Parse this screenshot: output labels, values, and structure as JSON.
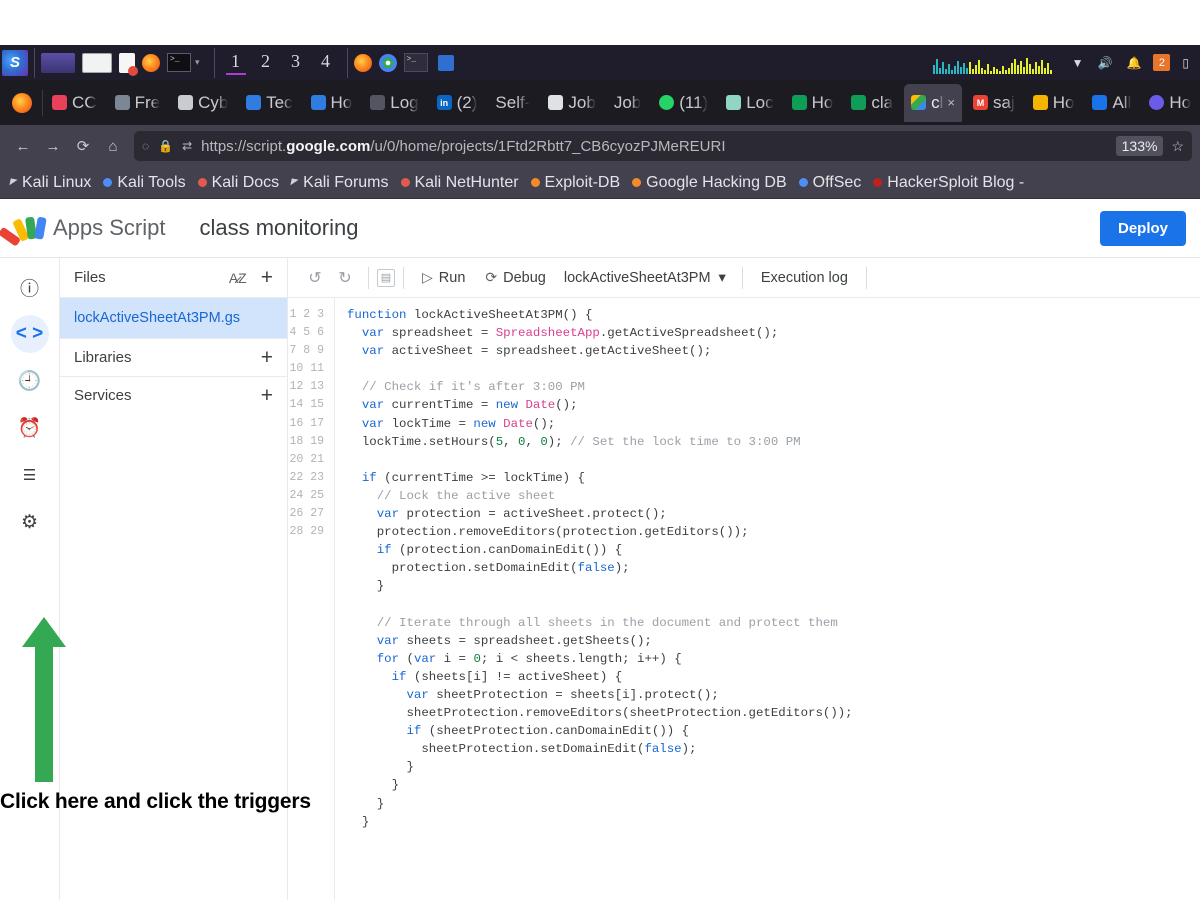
{
  "os_taskbar": {
    "workspaces": [
      "1",
      "2",
      "3",
      "4"
    ],
    "active_workspace": "1",
    "tray": {
      "wifi_icon": "wifi-icon",
      "volume_icon": "volume-icon",
      "bell_icon": "notification-bell-icon",
      "updates_badge": "2",
      "visualizer_label": "audio-visualizer"
    },
    "launchers": [
      "kali-menu",
      "window-purple",
      "window-white",
      "file-manager",
      "firefox",
      "terminal"
    ]
  },
  "browser": {
    "tabs": [
      {
        "label": "CC",
        "favicon": "chat-icon",
        "color": "#e8415a",
        "active": false
      },
      {
        "label": "Fre",
        "favicon": "grid-icon",
        "color": "#7b8794",
        "active": false
      },
      {
        "label": "Cyb",
        "favicon": "cyber-icon",
        "color": "#c8ccd1",
        "active": false
      },
      {
        "label": "Tec",
        "favicon": "doc-icon",
        "color": "#2f7de1",
        "active": false
      },
      {
        "label": "Ho",
        "favicon": "doc-icon",
        "color": "#2f7de1",
        "active": false
      },
      {
        "label": "Log",
        "favicon": "blank-icon",
        "color": "#555561",
        "active": false
      },
      {
        "label": "(2)",
        "favicon": "linkedin-icon",
        "color": "#0a66c2",
        "active": false
      },
      {
        "label": "Self-",
        "favicon": "blank-icon",
        "color": "#555561",
        "active": false
      },
      {
        "label": "Job",
        "favicon": "ghost-icon",
        "color": "#dfe1e5",
        "active": false
      },
      {
        "label": "Job",
        "favicon": "blank-icon",
        "color": "#555561",
        "active": false
      },
      {
        "label": "(11)",
        "favicon": "whatsapp-icon",
        "color": "#25d366",
        "active": false
      },
      {
        "label": "Loc",
        "favicon": "sheets-icon",
        "color": "#8fd6c4",
        "active": false
      },
      {
        "label": "Ho",
        "favicon": "sheets-icon",
        "color": "#0f9d58",
        "active": false
      },
      {
        "label": "cla",
        "favicon": "sheets-icon",
        "color": "#0f9d58",
        "active": false
      },
      {
        "label": "cl",
        "favicon": "apps-script-icon",
        "color": "#4285f4",
        "active": true
      },
      {
        "label": "saj",
        "favicon": "gmail-icon",
        "color": "#ea4335",
        "active": false
      },
      {
        "label": "Ho",
        "favicon": "contacts-icon",
        "color": "#f4b400",
        "active": false
      },
      {
        "label": "All",
        "favicon": "contacts-icon",
        "color": "#1a73e8",
        "active": false
      },
      {
        "label": "Ho",
        "favicon": "globe-icon",
        "color": "#6b5ce7",
        "active": false
      }
    ],
    "active_tab_close": "×",
    "nav": {
      "back_icon": "back-arrow-icon",
      "forward_icon": "forward-arrow-icon",
      "reload_icon": "reload-icon",
      "home_icon": "home-icon"
    },
    "address_bar": {
      "shield_icon": "shield-icon",
      "lock_icon": "lock-icon",
      "container_icon": "container-tabs-icon",
      "url_prefix": "https://script.",
      "url_domain": "google.com",
      "url_suffix": "/u/0/home/projects/1Ftd2Rbtt7_CB6cyozPJMeREURI",
      "zoom_level": "133%",
      "bookmark_icon": "star-icon"
    },
    "bookmarks": [
      {
        "label": "Kali Linux",
        "icon": "kali-dragon-icon",
        "color": "#d0d1d6"
      },
      {
        "label": "Kali Tools",
        "icon": "kali-tools-icon",
        "color": "#4f8ef7"
      },
      {
        "label": "Kali Docs",
        "icon": "kali-docs-icon",
        "color": "#e05b4b"
      },
      {
        "label": "Kali Forums",
        "icon": "kali-forums-icon",
        "color": "#d0d1d6"
      },
      {
        "label": "Kali NetHunter",
        "icon": "nethunter-icon",
        "color": "#e05b4b"
      },
      {
        "label": "Exploit-DB",
        "icon": "exploitdb-icon",
        "color": "#f28c28"
      },
      {
        "label": "Google Hacking DB",
        "icon": "ghdb-icon",
        "color": "#f28c28"
      },
      {
        "label": "OffSec",
        "icon": "offsec-icon",
        "color": "#4f8ef7"
      },
      {
        "label": "HackerSploit Blog -",
        "icon": "hackersploit-icon",
        "color": "#c0211f"
      }
    ]
  },
  "app": {
    "brand": "Apps Script",
    "logo_icon": "apps-script-logo-icon",
    "project_name": "class monitoring",
    "deploy_label": "Deploy",
    "accent_color": "#1a73e8"
  },
  "rail": [
    {
      "name": "overview",
      "icon": "info-circle-icon",
      "active": false
    },
    {
      "name": "editor",
      "icon": "code-brackets-icon",
      "active": true
    },
    {
      "name": "executions",
      "icon": "history-clock-icon",
      "active": false
    },
    {
      "name": "triggers",
      "icon": "alarm-clock-icon",
      "active": false
    },
    {
      "name": "logs",
      "icon": "list-lines-icon",
      "active": false
    },
    {
      "name": "settings",
      "icon": "gear-icon",
      "active": false
    }
  ],
  "files_panel": {
    "title": "Files",
    "sort_icon": "sort-az-icon",
    "add_icon": "plus-icon",
    "files": [
      {
        "name": "lockActiveSheetAt3PM.gs",
        "selected": true
      }
    ],
    "sections": [
      {
        "label": "Libraries",
        "add_icon": "plus-icon"
      },
      {
        "label": "Services",
        "add_icon": "plus-icon"
      }
    ]
  },
  "editor_toolbar": {
    "undo_icon": "undo-icon",
    "redo_icon": "redo-icon",
    "save_icon": "save-icon",
    "run_label": "Run",
    "run_icon": "play-icon",
    "debug_label": "Debug",
    "debug_icon": "debug-icon",
    "function_name": "lockActiveSheetAt3PM",
    "function_caret": "▾",
    "execution_log_label": "Execution log"
  },
  "code": {
    "first_line": 1,
    "last_line": 29,
    "lines": [
      "function lockActiveSheetAt3PM() {",
      "  var spreadsheet = SpreadsheetApp.getActiveSpreadsheet();",
      "  var activeSheet = spreadsheet.getActiveSheet();",
      "",
      "  // Check if it's after 3:00 PM",
      "  var currentTime = new Date();",
      "  var lockTime = new Date();",
      "  lockTime.setHours(5, 0, 0); // Set the lock time to 3:00 PM",
      "",
      "  if (currentTime >= lockTime) {",
      "    // Lock the active sheet",
      "    var protection = activeSheet.protect();",
      "    protection.removeEditors(protection.getEditors());",
      "    if (protection.canDomainEdit()) {",
      "      protection.setDomainEdit(false);",
      "    }",
      "",
      "    // Iterate through all sheets in the document and protect them",
      "    var sheets = spreadsheet.getSheets();",
      "    for (var i = 0; i < sheets.length; i++) {",
      "      if (sheets[i] != activeSheet) {",
      "        var sheetProtection = sheets[i].protect();",
      "        sheetProtection.removeEditors(sheetProtection.getEditors());",
      "        if (sheetProtection.canDomainEdit()) {",
      "          sheetProtection.setDomainEdit(false);",
      "        }",
      "      }",
      "    }",
      "  }"
    ]
  },
  "annotation": {
    "text": "Click here and click the triggers",
    "arrow_icon": "up-arrow-annotation",
    "arrow_color": "#34a853"
  }
}
